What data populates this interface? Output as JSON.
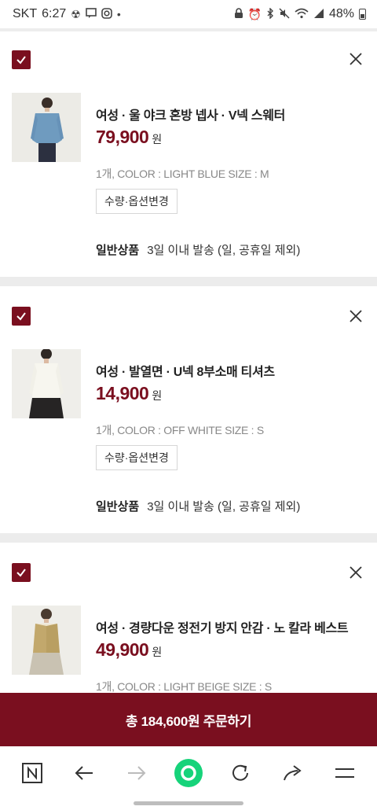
{
  "status_bar": {
    "carrier": "SKT",
    "time": "6:27",
    "battery_percent": "48%",
    "left_icons": [
      "radiation-icon",
      "message-icon",
      "instagram-icon",
      "dot-icon"
    ],
    "right_icons": [
      "lock-icon",
      "alarm-icon",
      "bluetooth-icon",
      "mute-icon",
      "wifi-icon",
      "signal-icon",
      "battery-icon"
    ]
  },
  "cart": {
    "items": [
      {
        "name": "여성 · 울 야크 혼방 넵사 · V넥 스웨터",
        "price": "79,900",
        "price_unit": "원",
        "options": "1개, COLOR : LIGHT BLUE SIZE : M",
        "change_label": "수량·옵션변경",
        "ship_type": "일반상품",
        "ship_info": "3일 이내 발송 (일, 공휴일 제외)",
        "checked": true
      },
      {
        "name": "여성 · 발열면 · U넥 8부소매 티셔츠",
        "price": "14,900",
        "price_unit": "원",
        "options": "1개, COLOR : OFF WHITE SIZE : S",
        "change_label": "수량·옵션변경",
        "ship_type": "일반상품",
        "ship_info": "3일 이내 발송 (일, 공휴일 제외)",
        "checked": true
      },
      {
        "name": "여성 · 경량다운 정전기 방지 안감 · 노 칼라 베스트",
        "price": "49,900",
        "price_unit": "원",
        "options": "1개, COLOR : LIGHT BEIGE SIZE : S",
        "checked": true
      }
    ]
  },
  "order_button": {
    "label": "총 184,600원 주문하기"
  },
  "browser_nav": {
    "buttons": [
      "tabs-n-icon",
      "back-arrow-icon",
      "forward-arrow-icon",
      "home-circle-icon",
      "reload-icon",
      "share-icon",
      "menu-icon"
    ]
  },
  "colors": {
    "accent": "#7a0f1f",
    "divider": "#ececec",
    "green": "#16d37a"
  }
}
